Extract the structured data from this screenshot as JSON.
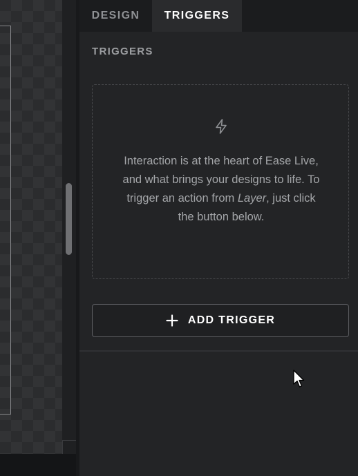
{
  "tabs": {
    "design": "DESIGN",
    "triggers": "TRIGGERS"
  },
  "triggers_panel": {
    "section_title": "TRIGGERS",
    "empty_state": {
      "icon": "lightning-bolt-icon",
      "text_part1": "Interaction is at the heart of Ease Live, and what brings your designs to life. To trigger an action from ",
      "text_emphasis": "Layer",
      "text_part2": ", just click the button below."
    },
    "add_trigger_button": {
      "icon": "plus-icon",
      "label": "ADD TRIGGER"
    }
  },
  "colors": {
    "panel_background": "#232426",
    "tab_active_text": "#ffffff",
    "tab_inactive_text": "#8f9194",
    "muted_text": "#a3a5a8"
  }
}
